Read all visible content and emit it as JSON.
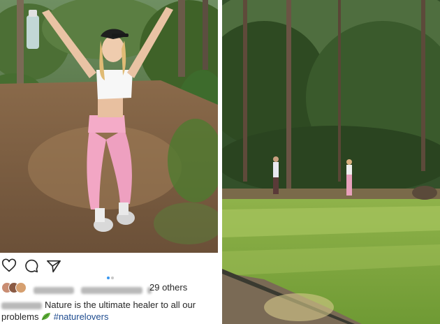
{
  "footer": {
    "icons": [
      "heart-icon",
      "comment-icon",
      "share-icon"
    ],
    "carousel": {
      "count": 2,
      "active": 1,
      "active_color": "#3897f0",
      "inactive_color": "#c7c7c7"
    },
    "likes_count_text": "29 others",
    "caption_text": "Nature is the ultimate healer to all our problems",
    "caption_hashtag": "#naturelovers"
  },
  "colors": {
    "hashtag": "#1e4b8f",
    "text": "#262626"
  }
}
